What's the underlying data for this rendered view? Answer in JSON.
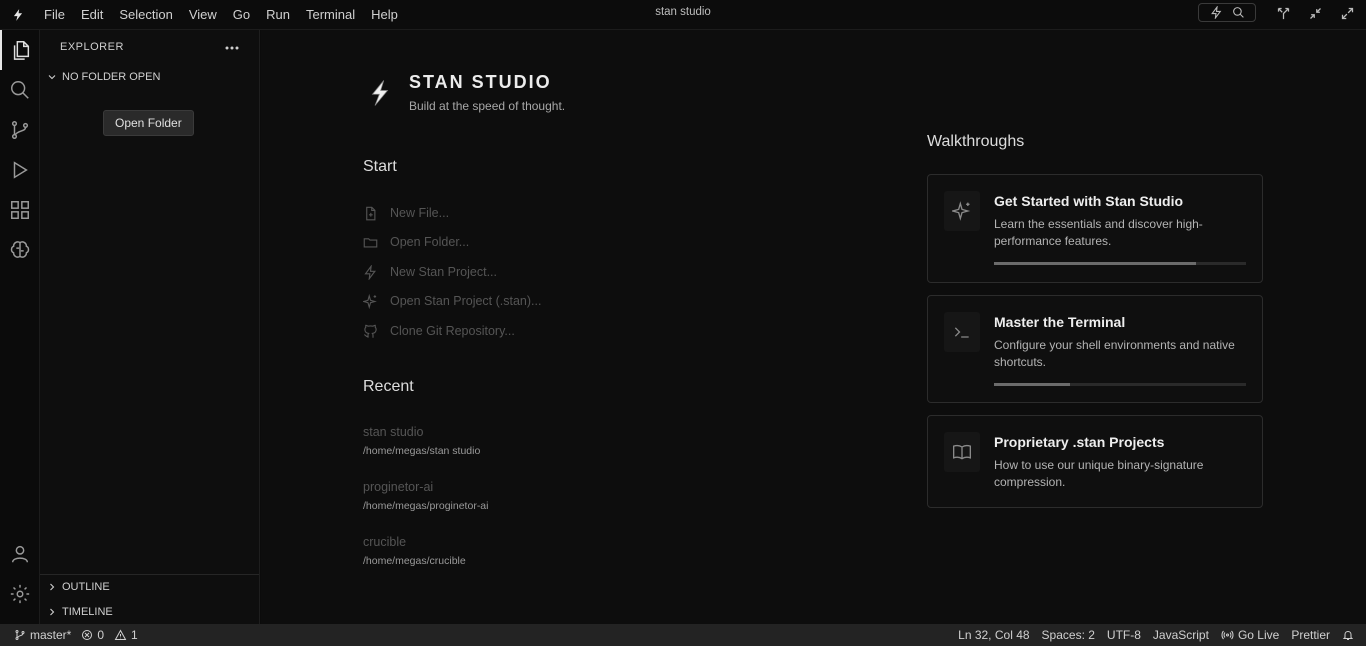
{
  "titlebar": {
    "menu": [
      "File",
      "Edit",
      "Selection",
      "View",
      "Go",
      "Run",
      "Terminal",
      "Help"
    ],
    "window_title": "stan studio"
  },
  "sidebar": {
    "header": "EXPLORER",
    "folder_section": "NO FOLDER OPEN",
    "tooltip": "Open Folder",
    "outline": "OUTLINE",
    "timeline": "TIMELINE"
  },
  "welcome": {
    "brand_name": "STAN STUDIO",
    "tagline": "Build at the speed of thought.",
    "start_heading": "Start",
    "start_items": [
      {
        "label": "New File...",
        "icon": "new-file-icon"
      },
      {
        "label": "Open Folder...",
        "icon": "folder-icon"
      },
      {
        "label": "New Stan Project...",
        "icon": "bolt-icon"
      },
      {
        "label": "Open Stan Project (.stan)...",
        "icon": "sparkle-icon"
      },
      {
        "label": "Clone Git Repository...",
        "icon": "github-icon"
      }
    ],
    "recent_heading": "Recent",
    "recent": [
      {
        "name": "stan studio",
        "path": "/home/megas/stan studio"
      },
      {
        "name": "proginetor-ai",
        "path": "/home/megas/proginetor-ai"
      },
      {
        "name": "crucible",
        "path": "/home/megas/crucible"
      }
    ],
    "walkthroughs_heading": "Walkthroughs",
    "walkthroughs": [
      {
        "title": "Get Started with Stan Studio",
        "desc": "Learn the essentials and discover high-performance features.",
        "icon": "sparkle-icon",
        "progress": 0.8
      },
      {
        "title": "Master the Terminal",
        "desc": "Configure your shell environments and native shortcuts.",
        "icon": "terminal-icon",
        "progress": 0.3
      },
      {
        "title": "Proprietary .stan Projects",
        "desc": "How to use our unique binary-signature compression.",
        "icon": "book-icon",
        "progress": null
      }
    ]
  },
  "statusbar": {
    "branch": "master*",
    "errors": "0",
    "warnings": "1",
    "position": "Ln 32, Col 48",
    "spaces": "Spaces: 2",
    "encoding": "UTF-8",
    "language": "JavaScript",
    "golive": "Go Live",
    "formatter": "Prettier"
  },
  "colors": {
    "background": "#0d0d0d",
    "statusbar": "#232323",
    "accent": "#e6e6e6"
  }
}
